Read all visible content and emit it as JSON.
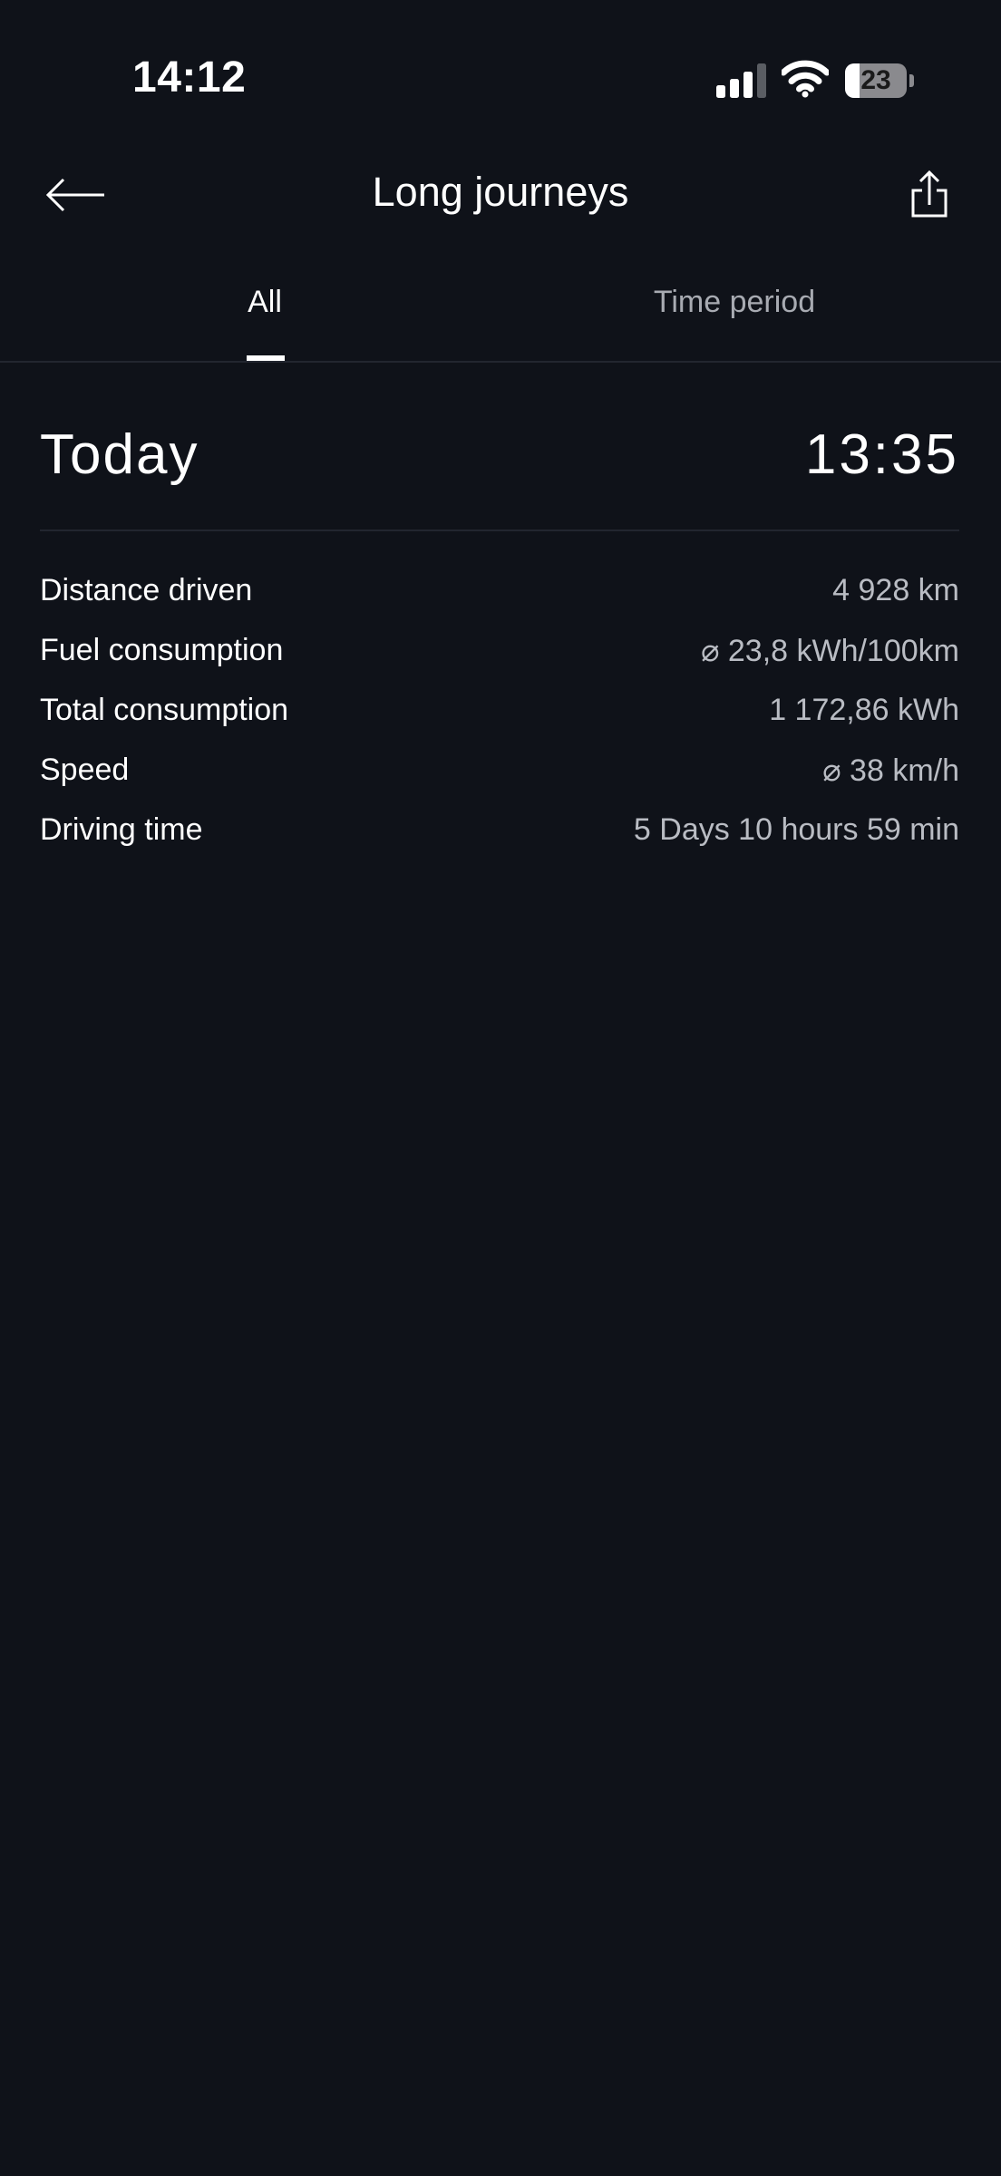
{
  "status_bar": {
    "time": "14:12",
    "battery_level": "23",
    "battery_fraction": 0.23
  },
  "header": {
    "title": "Long journeys",
    "back_icon": "arrow-left-icon",
    "share_icon": "share-icon"
  },
  "tabs": [
    {
      "label": "All",
      "active": true
    },
    {
      "label": "Time period",
      "active": false
    }
  ],
  "summary": {
    "label": "Today",
    "time": "13:35"
  },
  "stats": [
    {
      "label": "Distance driven",
      "value": "4 928 km"
    },
    {
      "label": "Fuel consumption",
      "value": "⌀ 23,8 kWh/100km"
    },
    {
      "label": "Total consumption",
      "value": "1 172,86 kWh"
    },
    {
      "label": "Speed",
      "value": "⌀ 38 km/h"
    },
    {
      "label": "Driving time",
      "value": "5 Days 10 hours 59 min"
    }
  ],
  "colors": {
    "background": "#0f1219",
    "text_primary": "#ffffff",
    "text_secondary": "#b9bcc3",
    "divider": "#22262f"
  }
}
